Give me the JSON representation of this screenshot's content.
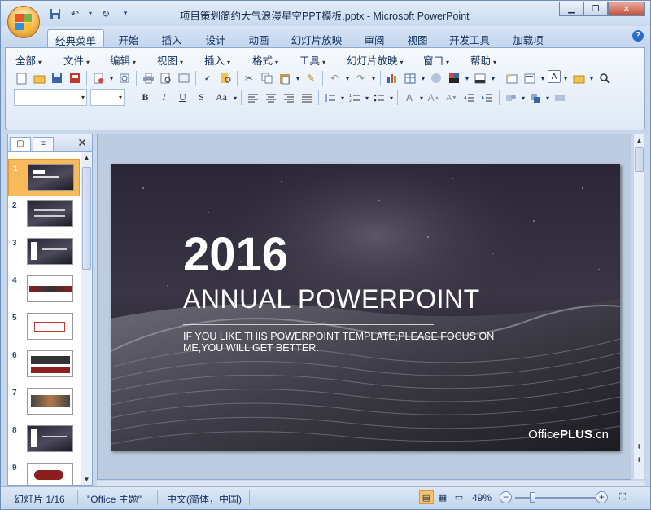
{
  "window": {
    "title": "项目策划简约大气浪漫星空PPT模板.pptx - Microsoft PowerPoint",
    "controls": [
      "minimize-icon",
      "restore-icon",
      "close-icon"
    ]
  },
  "quick_access": {
    "icons": [
      "save-icon",
      "undo-icon",
      "redo-icon",
      "customize-icon"
    ]
  },
  "tabs": [
    {
      "label": "经典菜单",
      "active": true
    },
    {
      "label": "开始"
    },
    {
      "label": "插入"
    },
    {
      "label": "设计"
    },
    {
      "label": "动画"
    },
    {
      "label": "幻灯片放映"
    },
    {
      "label": "审阅"
    },
    {
      "label": "视图"
    },
    {
      "label": "开发工具"
    },
    {
      "label": "加载项"
    }
  ],
  "menus": [
    {
      "label": "全部"
    },
    {
      "label": "文件"
    },
    {
      "label": "编辑"
    },
    {
      "label": "视图"
    },
    {
      "label": "插入"
    },
    {
      "label": "格式"
    },
    {
      "label": "工具"
    },
    {
      "label": "幻灯片放映"
    },
    {
      "label": "窗口"
    },
    {
      "label": "帮助"
    }
  ],
  "format_buttons": [
    "B",
    "I",
    "U",
    "S",
    "Aa"
  ],
  "slides_panel": {
    "tab_icons": [
      "slides-tab-icon",
      "outline-tab-icon"
    ],
    "thumbnails": [
      {
        "num": "1",
        "selected": true
      },
      {
        "num": "2"
      },
      {
        "num": "3"
      },
      {
        "num": "4"
      },
      {
        "num": "5"
      },
      {
        "num": "6"
      },
      {
        "num": "7"
      },
      {
        "num": "8"
      },
      {
        "num": "9"
      }
    ]
  },
  "slide": {
    "year": "2016",
    "title": "ANNUAL POWERPOINT",
    "subtitle": "IF YOU LIKE THIS POWERPOINT TEMPLATE,PLEASE FOCUS ON ME,YOU WILL GET BETTER.",
    "logo_a": "Office",
    "logo_b": "PLUS",
    "logo_c": ".cn"
  },
  "status": {
    "slide_counter": "幻灯片 1/16",
    "theme": "\"Office 主题\"",
    "language": "中文(简体，中国)",
    "zoom": "49%",
    "zoom_fraction": 0.49
  },
  "colors": {
    "ribbon_bg": "#dfe9f6",
    "selected_thumb": "#f8b95a",
    "close_button": "#c4503a"
  }
}
